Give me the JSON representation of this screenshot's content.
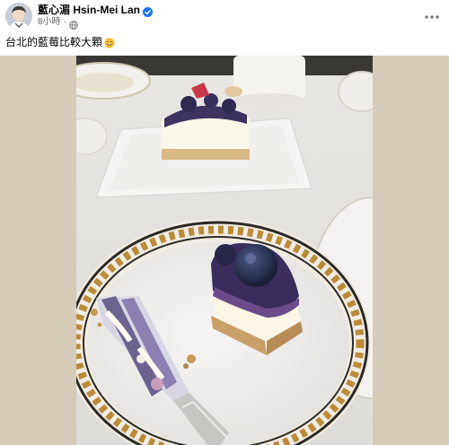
{
  "post": {
    "author_name": "藍心湄 Hsin-Mei Lan",
    "timestamp": "8小時",
    "text": "台北的藍莓比較大顆",
    "icons": {
      "verified": "verified-badge-icon",
      "audience": "globe-icon",
      "more": "more-options-icon",
      "emoji": "smiling-face-emoji-icon"
    },
    "colors": {
      "verified": "#1877f2",
      "text": "#050505",
      "secondary_text": "#65676b",
      "photo_backdrop": "#d4cbb9"
    }
  }
}
